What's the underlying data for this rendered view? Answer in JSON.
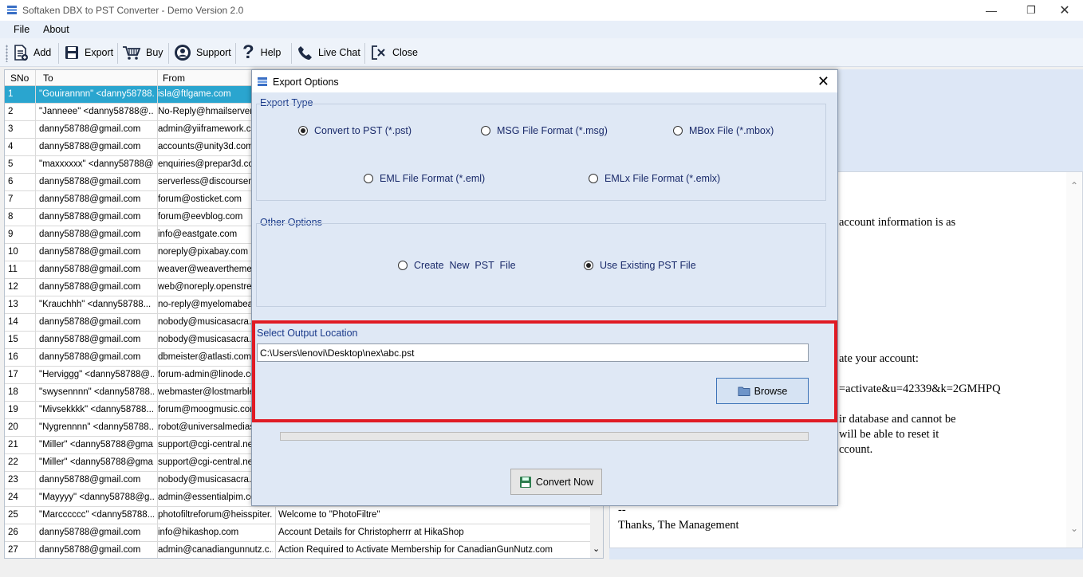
{
  "window": {
    "title": "Softaken DBX to PST Converter - Demo Version 2.0"
  },
  "menu": {
    "file": "File",
    "about": "About"
  },
  "toolbar": {
    "add": "Add",
    "export": "Export",
    "buy": "Buy",
    "support": "Support",
    "help": "Help",
    "live_chat": "Live Chat",
    "close": "Close"
  },
  "grid": {
    "headers": {
      "sno": "SNo",
      "to": "To",
      "from": "From"
    },
    "rows": [
      {
        "sno": "1",
        "to": "\"Gouirannnn\" <danny58788...",
        "from": "isla@ftlgame.com",
        "subject": ""
      },
      {
        "sno": "2",
        "to": "\"Janneee\" <danny58788@...",
        "from": "No-Reply@hmailserver.co",
        "subject": ""
      },
      {
        "sno": "3",
        "to": "danny58788@gmail.com",
        "from": "admin@yiiframework.com",
        "subject": ""
      },
      {
        "sno": "4",
        "to": "danny58788@gmail.com",
        "from": "accounts@unity3d.com",
        "subject": ""
      },
      {
        "sno": "5",
        "to": "\"maxxxxxx\" <danny58788@...",
        "from": "enquiries@prepar3d.com",
        "subject": ""
      },
      {
        "sno": "6",
        "to": "danny58788@gmail.com",
        "from": "serverless@discoursema",
        "subject": ""
      },
      {
        "sno": "7",
        "to": "danny58788@gmail.com",
        "from": "forum@osticket.com",
        "subject": ""
      },
      {
        "sno": "8",
        "to": "danny58788@gmail.com",
        "from": "forum@eevblog.com",
        "subject": ""
      },
      {
        "sno": "9",
        "to": "danny58788@gmail.com",
        "from": "info@eastgate.com",
        "subject": ""
      },
      {
        "sno": "10",
        "to": "danny58788@gmail.com",
        "from": "noreply@pixabay.com",
        "subject": ""
      },
      {
        "sno": "11",
        "to": "danny58788@gmail.com",
        "from": "weaver@weavertheme.co",
        "subject": ""
      },
      {
        "sno": "12",
        "to": "danny58788@gmail.com",
        "from": "web@noreply.openstreet",
        "subject": ""
      },
      {
        "sno": "13",
        "to": "\"Krauchhh\" <danny58788...",
        "from": "no-reply@myelomabeac",
        "subject": ""
      },
      {
        "sno": "14",
        "to": "danny58788@gmail.com",
        "from": "nobody@musicasacra.co",
        "subject": ""
      },
      {
        "sno": "15",
        "to": "danny58788@gmail.com",
        "from": "nobody@musicasacra.co",
        "subject": ""
      },
      {
        "sno": "16",
        "to": "danny58788@gmail.com",
        "from": "dbmeister@atlasti.com",
        "subject": ""
      },
      {
        "sno": "17",
        "to": "\"Herviggg\" <danny58788@...",
        "from": "forum-admin@linode.com",
        "subject": ""
      },
      {
        "sno": "18",
        "to": "\"swysennnn\" <danny58788...",
        "from": "webmaster@lostmarble.c",
        "subject": ""
      },
      {
        "sno": "19",
        "to": "\"Mivsekkkk\" <danny58788...",
        "from": "forum@moogmusic.com",
        "subject": ""
      },
      {
        "sno": "20",
        "to": "\"Nygrennnn\" <danny58788...",
        "from": "robot@universalmediase",
        "subject": ""
      },
      {
        "sno": "21",
        "to": "\"Miller\" <danny58788@gma...",
        "from": "support@cgi-central.net",
        "subject": ""
      },
      {
        "sno": "22",
        "to": "\"Miller\" <danny58788@gma...",
        "from": "support@cgi-central.net",
        "subject": ""
      },
      {
        "sno": "23",
        "to": "danny58788@gmail.com",
        "from": "nobody@musicasacra.co",
        "subject": ""
      },
      {
        "sno": "24",
        "to": "\"Mayyyy\" <danny58788@g...",
        "from": "admin@essentialpim.con",
        "subject": ""
      },
      {
        "sno": "25",
        "to": "\"Marcccccc\" <danny58788...",
        "from": "photofiltreforum@heisspiter....",
        "subject": "Welcome to \"PhotoFiltre\""
      },
      {
        "sno": "26",
        "to": "danny58788@gmail.com",
        "from": "info@hikashop.com",
        "subject": "Account Details for Christopherrr at HikaShop"
      },
      {
        "sno": "27",
        "to": "danny58788@gmail.com",
        "from": "admin@canadiangunnutz.c...",
        "subject": "Action Required to Activate Membership for CanadianGunNutz.com"
      }
    ]
  },
  "preview": {
    "lines": [
      "account information is as",
      "ate your account:",
      "=activate&u=42339&k=2GMHPQ",
      "ir database and cannot be",
      "will be able to reset it",
      "ccount.",
      "--",
      "Thanks, The Management"
    ]
  },
  "dialog": {
    "title": "Export Options",
    "export_type_label": "Export Type",
    "options": {
      "pst": "Convert to PST (*.pst)",
      "msg": "MSG File Format (*.msg)",
      "mbox": "MBox File (*.mbox)",
      "eml": "EML File Format (*.eml)",
      "emlx": "EMLx File Format (*.emlx)"
    },
    "other_options_label": "Other Options",
    "create_new": "Create  New  PST  File",
    "use_existing": "Use Existing PST File",
    "output_label": "Select Output Location",
    "output_path": "C:\\Users\\lenovi\\Desktop\\nex\\abc.pst",
    "browse": "Browse",
    "convert": "Convert Now",
    "progress": 0
  },
  "colors": {
    "selected_row": "#2aa5cf",
    "highlight_border": "#e01b24",
    "dialog_bg": "#dfe8f5"
  }
}
